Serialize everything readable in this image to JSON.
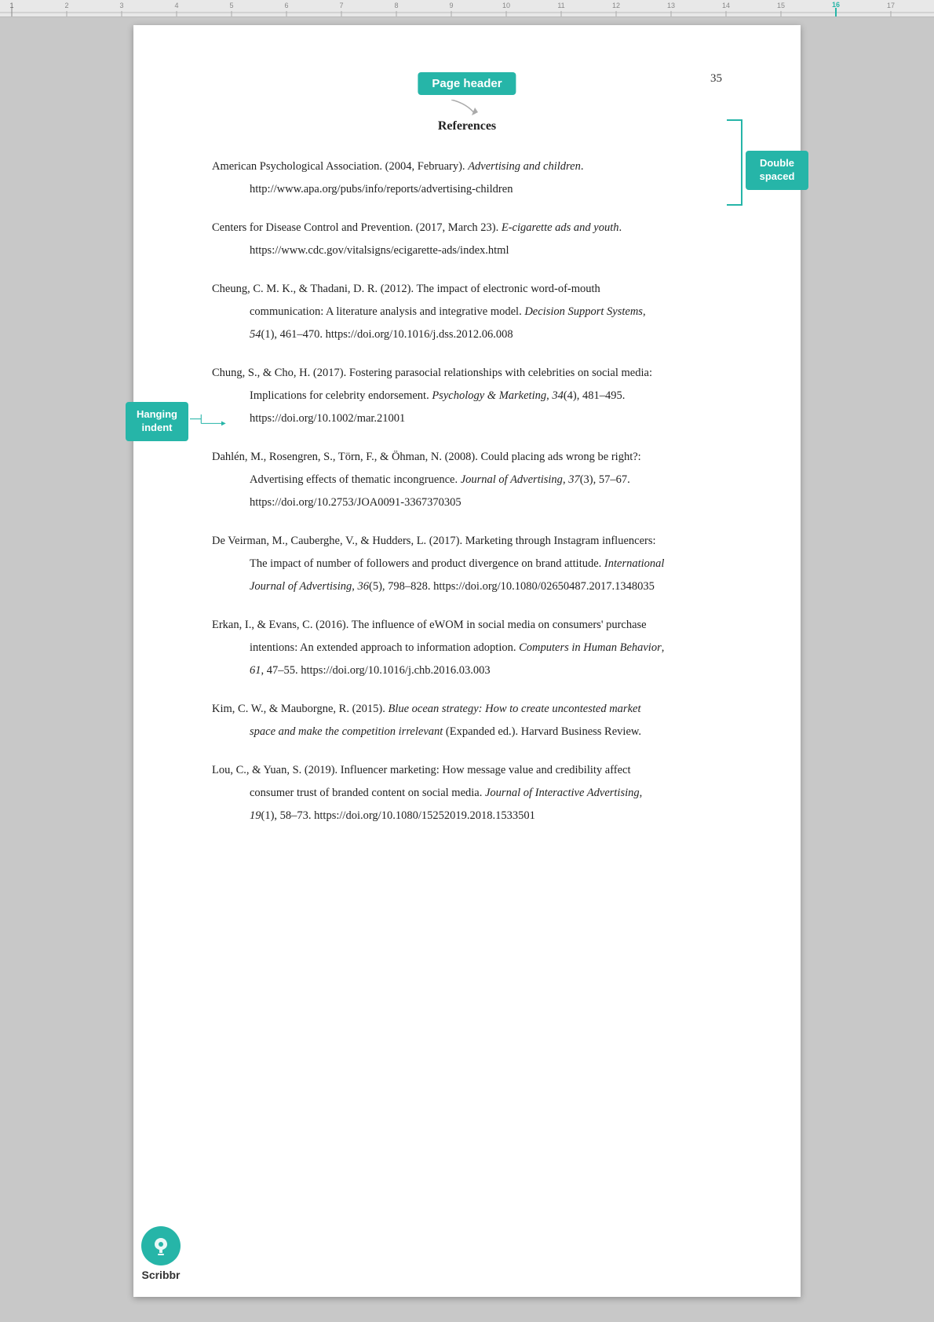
{
  "ruler": {
    "numbers": [
      1,
      2,
      3,
      4,
      5,
      6,
      7,
      8,
      9,
      10,
      11,
      12,
      13,
      14,
      15,
      16,
      17
    ]
  },
  "page": {
    "header_label": "Page header",
    "page_number": "35",
    "references_heading": "References"
  },
  "badges": {
    "double_spaced": "Double\nspaced",
    "hanging_indent": "Hanging\nindent"
  },
  "references": [
    {
      "id": "ref1",
      "first_line": "American Psychological Association. (2004, February). ",
      "first_line_italic": "Advertising and children",
      "first_line_end": ".",
      "continuation": "http://www.apa.org/pubs/info/reports/advertising-children"
    },
    {
      "id": "ref2",
      "first_line": "Centers for Disease Control and Prevention. (2017, March 23). ",
      "first_line_italic": "E-cigarette ads and youth",
      "first_line_end": ".",
      "continuation": "https://www.cdc.gov/vitalsigns/ecigarette-ads/index.html"
    },
    {
      "id": "ref3",
      "first_line": "Cheung, C. M. K., & Thadani, D. R. (2012). The impact of electronic word-of-mouth",
      "continuation1": "communication: A literature analysis and integrative model. ",
      "continuation1_italic": "Decision Support Systems",
      "continuation1_end": ",",
      "continuation2": "54(1), 461–470. https://doi.org/10.1016/j.dss.2012.06.008"
    },
    {
      "id": "ref4",
      "first_line": "Chung, S., & Cho, H. (2017). Fostering parasocial relationships with celebrities on social media:",
      "continuation1": "Implications for celebrity endorsement. ",
      "continuation1_italic": "Psychology & Marketing",
      "continuation1_end": ", 34(4), 481–495.",
      "continuation2": "https://doi.org/10.1002/mar.21001"
    },
    {
      "id": "ref5",
      "first_line": "Dahlén, M., Rosengren, S., Törn, F., & Öhman, N. (2008). Could placing ads wrong be right?:",
      "continuation1": "Advertising effects of thematic incongruence. ",
      "continuation1_italic": "Journal of Advertising",
      "continuation1_end": ", 37(3), 57–67.",
      "continuation2": "https://doi.org/10.2753/JOA0091-3367370305"
    },
    {
      "id": "ref6",
      "first_line": "De Veirman, M., Cauberghe, V., & Hudders, L. (2017). Marketing through Instagram influencers:",
      "continuation1": "The impact of number of followers and product divergence on brand attitude. ",
      "continuation1_italic": "International",
      "continuation2_italic": "Journal of Advertising",
      "continuation2_end": ", 36(5), 798–828. https://doi.org/10.1080/02650487.2017.1348035"
    },
    {
      "id": "ref7",
      "first_line": "Erkan, I., & Evans, C. (2016). The influence of eWOM in social media on consumers' purchase",
      "continuation1": "intentions: An extended approach to information adoption. ",
      "continuation1_italic": "Computers in Human Behavior",
      "continuation1_end": ",",
      "continuation2_italic": "61",
      "continuation2_end": ", 47–55. https://doi.org/10.1016/j.chb.2016.03.003"
    },
    {
      "id": "ref8",
      "first_line": "Kim, C. W., & Mauborgne, R. (2015). ",
      "first_line_italic": "Blue ocean strategy: How to create uncontested market",
      "continuation1_italic": "space and make the competition irrelevant",
      "continuation1_end": " (Expanded ed.). Harvard Business Review."
    },
    {
      "id": "ref9",
      "first_line": "Lou, C., & Yuan, S. (2019). Influencer marketing: How message value and credibility affect",
      "continuation1": "consumer trust of branded content on social media. ",
      "continuation1_italic": "Journal of Interactive Advertising",
      "continuation1_end": ",",
      "continuation2_italic": "19",
      "continuation2_end": "(1), 58–73. https://doi.org/10.1080/15252019.2018.1533501"
    }
  ],
  "scribbr": {
    "name": "Scribbr"
  }
}
